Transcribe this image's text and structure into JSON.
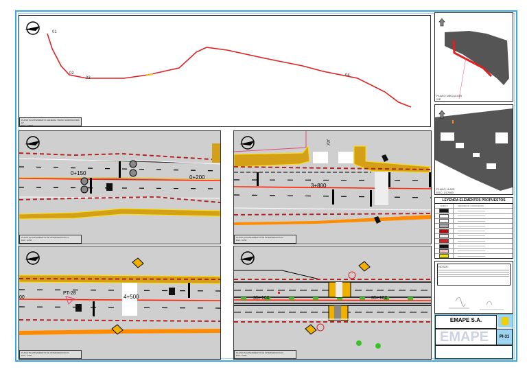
{
  "top_plan": {
    "tag": "PLANO PLANTEAMIENTO GENERAL TRAMO HORMIGONES ET",
    "scale": "ESC: 1/7500",
    "points": [
      "01",
      "02",
      "03",
      "04"
    ]
  },
  "panels": [
    {
      "tag": "PLANO PLANTEAMIENTO DE INTERVENCION 01",
      "scale": "ESC: 1/250",
      "stations": [
        "0+150",
        "0+200"
      ]
    },
    {
      "tag": "PLANO PLANTEAMIENTO DE INTERVENCION 02",
      "scale": "ESC: 1/250",
      "stations": [
        "3+800"
      ],
      "street": "AV."
    },
    {
      "tag": "PLANO PLANTEAMIENTO DE INTERVENCION 03",
      "scale": "ESC: 1/250",
      "stations": [
        "4+500",
        "PT-28",
        "00"
      ]
    },
    {
      "tag": "PLANO PLANTEAMIENTO DE INTERVENCION 04",
      "scale": "ESC: 1/250",
      "stations": [
        "35+100",
        "35+100"
      ]
    }
  ],
  "maps": {
    "location_label": "PLANO UBICACION",
    "location_scale": "S/E",
    "key_label": "PLANO LLAVE",
    "key_scale": "ESC: 1/17500"
  },
  "legend": {
    "title": "LEYENDA ELEMENTOS PROPUESTOS",
    "col_symbol": "SIMBOLO",
    "col_desc": "DESCRIPCION / CODIFICACION",
    "rows": 11
  },
  "notes": {
    "title": "NOTAS:"
  },
  "title_block": {
    "company": "EMAPE S.A.",
    "watermark": "EMAPE",
    "sheet": "PI-31"
  },
  "colors": {
    "frame": "#3aa8e0",
    "axis": "#ff2200",
    "curb": "#d4a017",
    "orange": "#ff8c00",
    "dashed": "#b22222"
  }
}
